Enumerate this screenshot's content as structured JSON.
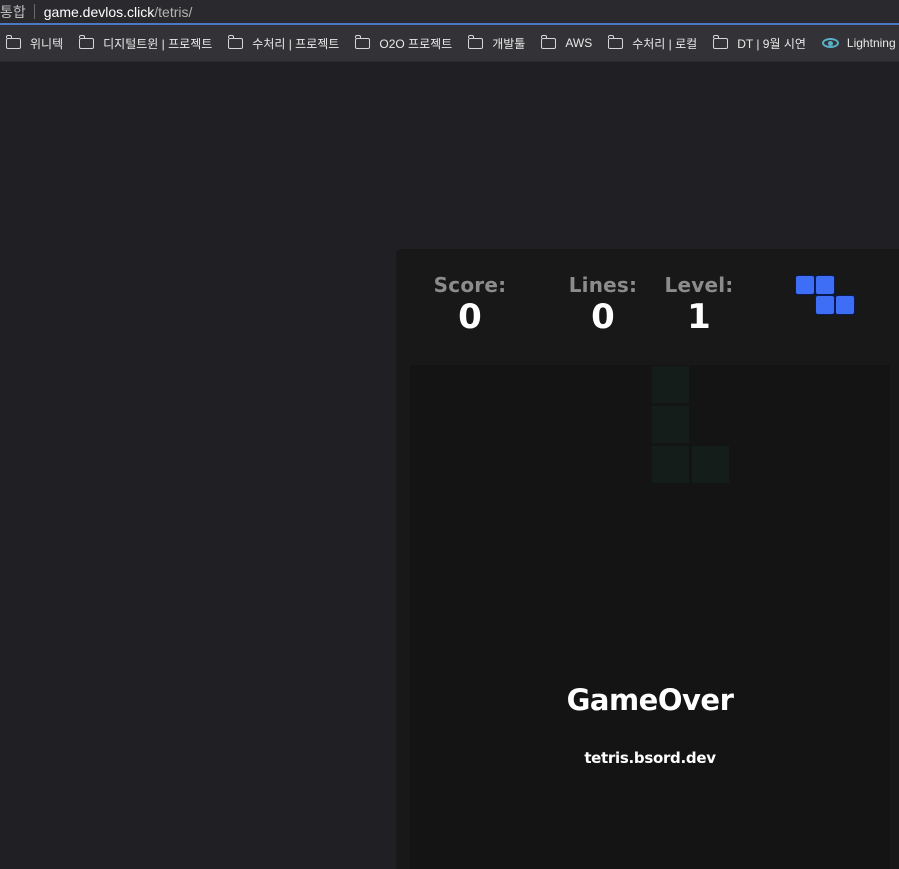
{
  "browser": {
    "url_prefix": "통합",
    "url_host": "game.devlos.click",
    "url_path": "/tetris/"
  },
  "bookmarks": [
    {
      "label": "위니텍",
      "icon": "folder-icon"
    },
    {
      "label": "디지털트윈 | 프로젝트",
      "icon": "folder-icon"
    },
    {
      "label": "수처리 | 프로젝트",
      "icon": "folder-icon"
    },
    {
      "label": "O2O 프로젝트",
      "icon": "folder-icon"
    },
    {
      "label": "개발툴",
      "icon": "folder-icon"
    },
    {
      "label": "AWS",
      "icon": "folder-icon"
    },
    {
      "label": "수처리 | 로컬",
      "icon": "folder-icon"
    },
    {
      "label": "DT | 9월 시연",
      "icon": "folder-icon"
    },
    {
      "label": "Lightning Labs",
      "icon": "eye-icon"
    }
  ],
  "game": {
    "score_label": "Score:",
    "score": "0",
    "lines_label": "Lines:",
    "lines": "0",
    "level_label": "Level:",
    "level": "1",
    "next_piece": "Z",
    "next_piece_color": "#3d6ef5",
    "ghost_piece": "L",
    "gameover_title": "GameOver",
    "gameover_url": "tetris.bsord.dev"
  }
}
